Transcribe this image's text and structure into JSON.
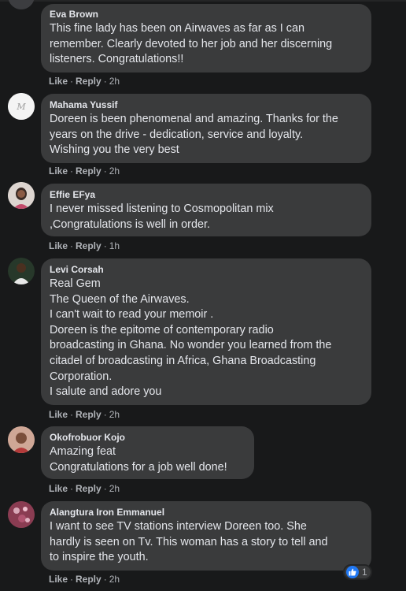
{
  "comments": [
    {
      "author": "Eva Brown",
      "lines": [
        "This fine lady has been on Airwaves as far as I can",
        "remember. Clearly devoted to her job and her discerning",
        "listeners. Congratulations!!"
      ],
      "like_label": "Like",
      "reply_label": "Reply",
      "time": "2h"
    },
    {
      "author": "Mahama Yussif",
      "lines": [
        "Doreen is been phenomenal and amazing. Thanks for the",
        "years on the drive - dedication, service and loyalty.",
        "Wishing you the very best"
      ],
      "like_label": "Like",
      "reply_label": "Reply",
      "time": "2h"
    },
    {
      "author": "Effie EFya",
      "lines": [
        "I never missed listening to Cosmopolitan mix",
        ",Congratulations is well in order."
      ],
      "like_label": "Like",
      "reply_label": "Reply",
      "time": "1h"
    },
    {
      "author": "Levi Corsah",
      "lines": [
        "Real Gem",
        "The Queen of the Airwaves.",
        "I can't wait to read your memoir .",
        "Doreen is the epitome of contemporary radio",
        "broadcasting in Ghana. No wonder you learned from the",
        "citadel of broadcasting in Africa, Ghana Broadcasting",
        "Corporation.",
        "I salute and adore you"
      ],
      "like_label": "Like",
      "reply_label": "Reply",
      "time": "2h"
    },
    {
      "author": "Okofrobuor Kojo",
      "lines": [
        "Amazing feat",
        "Congratulations for a job well done!"
      ],
      "like_label": "Like",
      "reply_label": "Reply",
      "time": "2h"
    },
    {
      "author": "Alangtura Iron Emmanuel",
      "lines": [
        "I want to see TV stations interview Doreen too. She",
        "hardly is seen on Tv. This woman has a story to tell and",
        "to inspire the youth."
      ],
      "like_label": "Like",
      "reply_label": "Reply",
      "time": "2h",
      "reaction_count": "1",
      "reaction_icon": "thumbs-up-icon"
    }
  ],
  "separator": "·",
  "colors": {
    "background": "#18191a",
    "bubble": "#3a3b3c",
    "text": "#e4e6eb",
    "muted": "#b0b3b8",
    "like_blue": "#2078f4"
  }
}
